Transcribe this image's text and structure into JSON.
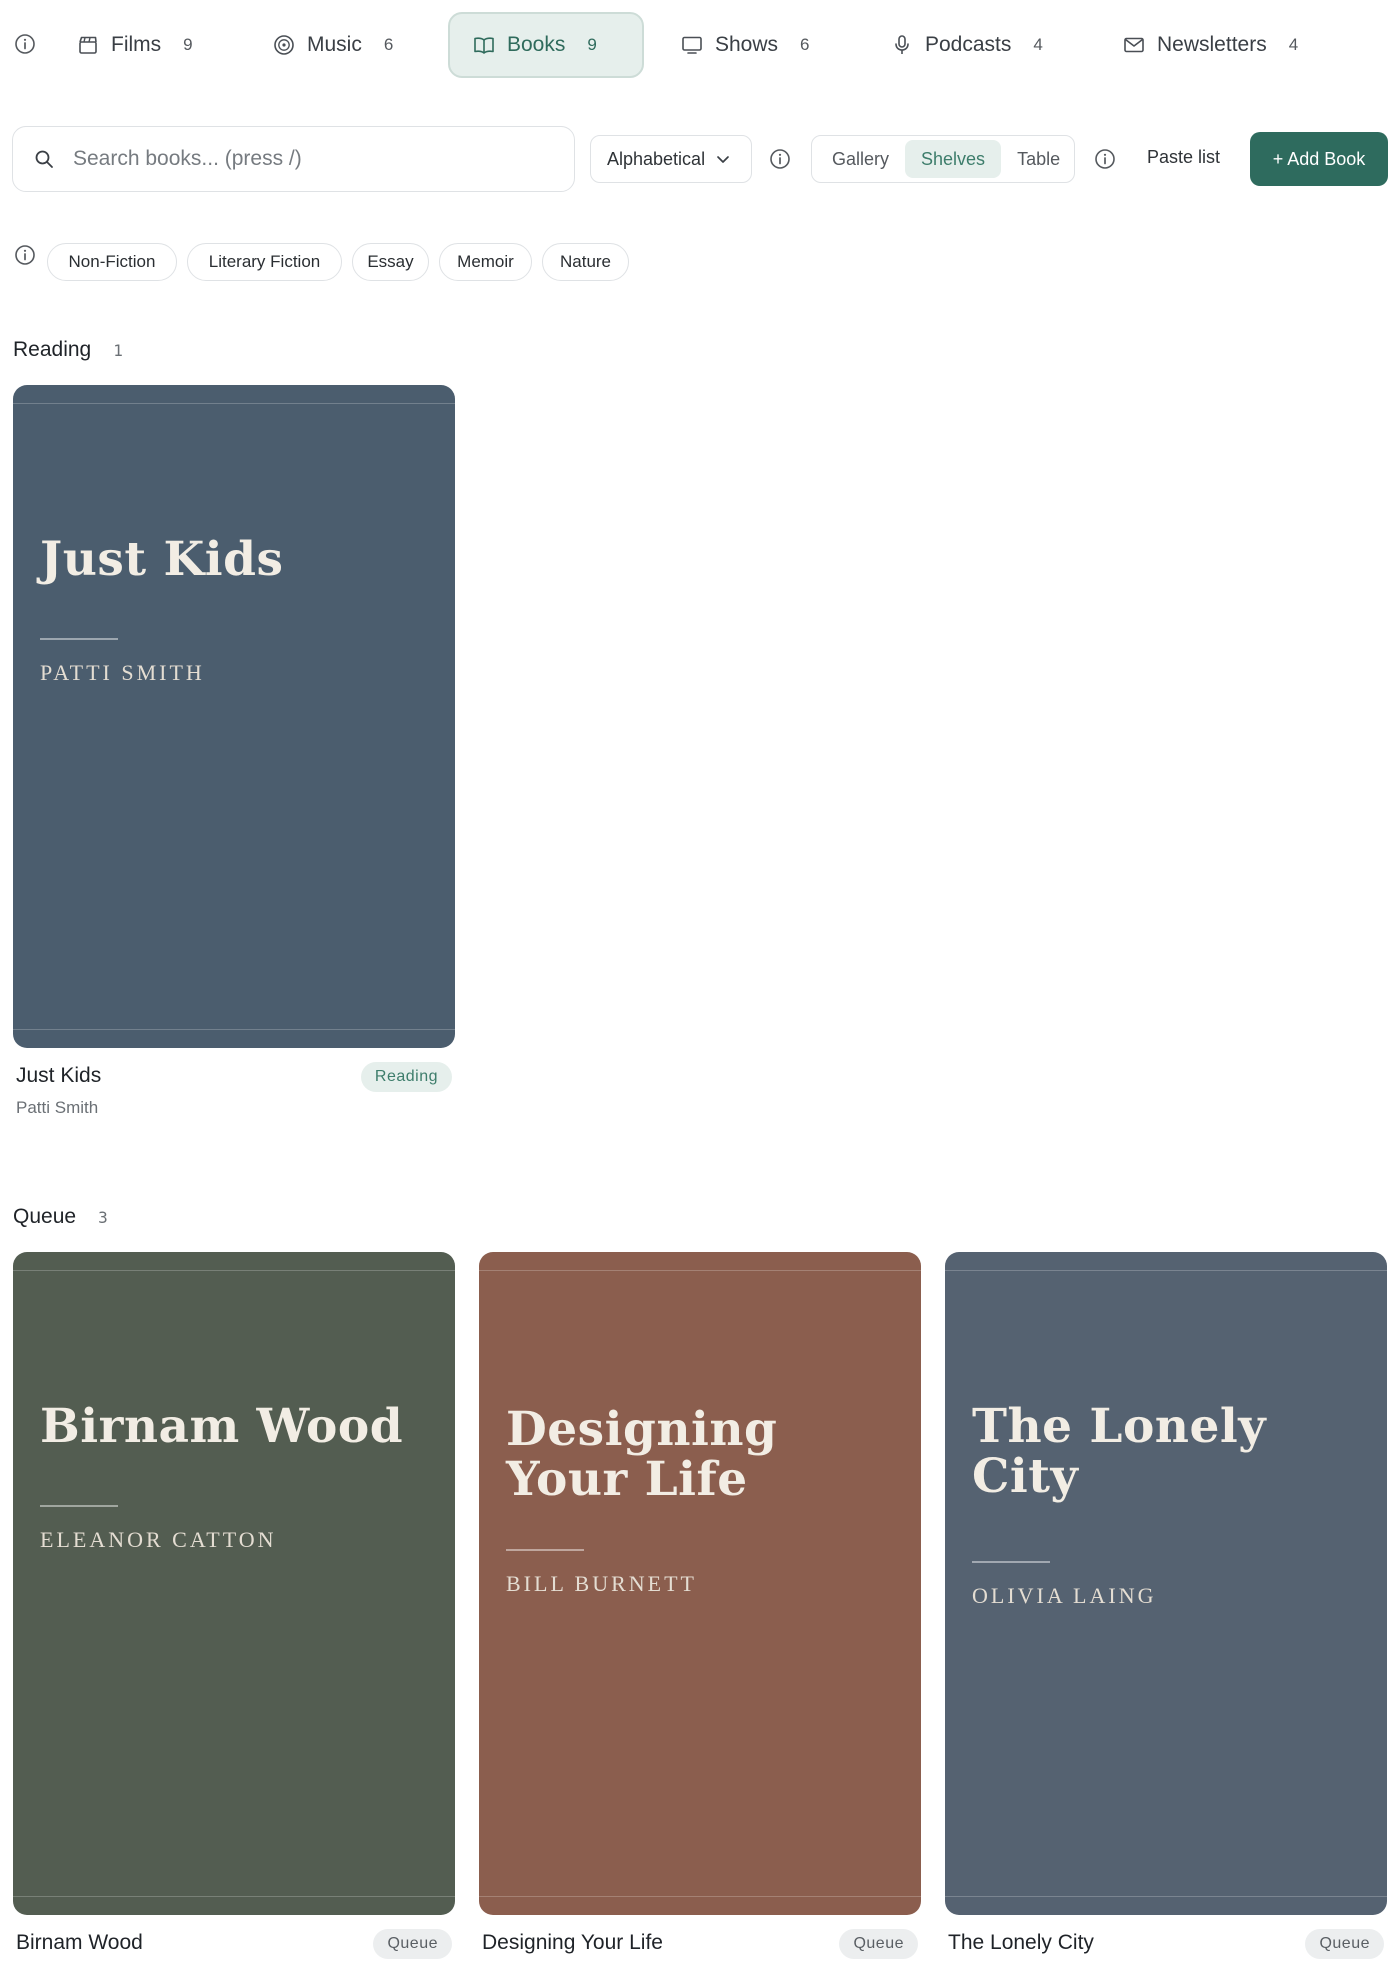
{
  "nav": {
    "tabs": [
      {
        "id": "films",
        "label": "Films",
        "count": "9",
        "icon": "clapperboard-icon"
      },
      {
        "id": "music",
        "label": "Music",
        "count": "6",
        "icon": "vinyl-disc-icon"
      },
      {
        "id": "books",
        "label": "Books",
        "count": "9",
        "icon": "open-book-icon",
        "active": true
      },
      {
        "id": "shows",
        "label": "Shows",
        "count": "6",
        "icon": "monitor-icon"
      },
      {
        "id": "podcasts",
        "label": "Podcasts",
        "count": "4",
        "icon": "microphone-icon"
      },
      {
        "id": "newsletters",
        "label": "Newsletters",
        "count": "4",
        "icon": "envelope-icon"
      }
    ]
  },
  "toolbar": {
    "search_placeholder": "Search books... (press /)",
    "sort_label": "Alphabetical",
    "views": [
      {
        "label": "Gallery",
        "active": false
      },
      {
        "label": "Shelves",
        "active": true
      },
      {
        "label": "Table",
        "active": false
      }
    ],
    "paste_label": "Paste list",
    "add_label": "+ Add Book"
  },
  "genres": [
    "Non-Fiction",
    "Literary Fiction",
    "Essay",
    "Memoir",
    "Nature"
  ],
  "sections": [
    {
      "name": "Reading",
      "count": "1",
      "books": [
        {
          "title": "Just Kids",
          "author": "Patti Smith",
          "cover_title": "Just Kids",
          "cover_author": "PATTI SMITH",
          "status": "Reading",
          "cover_color": "#4b5d6e"
        }
      ]
    },
    {
      "name": "Queue",
      "count": "3",
      "books": [
        {
          "title": "Birnam Wood",
          "author": "Eleanor Catton",
          "cover_title": "Birnam Wood",
          "cover_author": "ELEANOR CATTON",
          "status": "Queue",
          "cover_color": "#535d51"
        },
        {
          "title": "Designing Your Life",
          "author": "Bill Burnett",
          "cover_title": "Designing Your Life",
          "cover_author": "BILL BURNETT",
          "status": "Queue",
          "cover_color": "#8b5e4e"
        },
        {
          "title": "The Lonely City",
          "author": "Olivia Laing",
          "cover_title": "The Lonely City",
          "cover_author": "OLIVIA LAING",
          "status": "Queue",
          "cover_color": "#556271"
        }
      ]
    }
  ],
  "colors": {
    "accent": "#2e6b5e",
    "accent_soft": "#e6efec",
    "accent_text": "#3d7d6b"
  }
}
